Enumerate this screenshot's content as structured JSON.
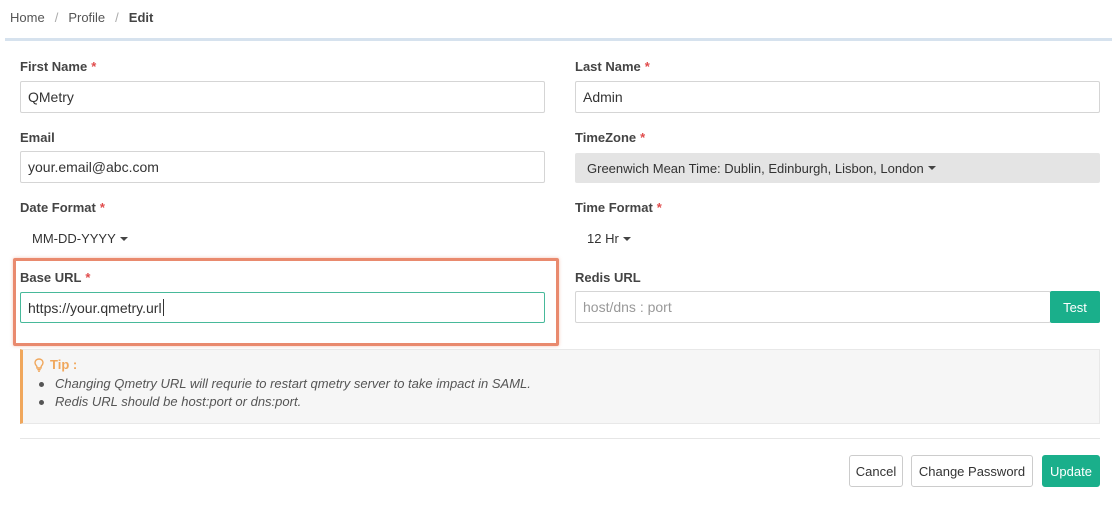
{
  "breadcrumb": {
    "home": "Home",
    "profile": "Profile",
    "current": "Edit",
    "separator": "/"
  },
  "form": {
    "first_name": {
      "label": "First Name",
      "required": "*",
      "value": "QMetry"
    },
    "last_name": {
      "label": "Last Name",
      "required": "*",
      "value": "Admin"
    },
    "email": {
      "label": "Email",
      "value": "your.email@abc.com"
    },
    "timezone": {
      "label": "TimeZone",
      "required": "*",
      "value": "Greenwich Mean Time: Dublin, Edinburgh, Lisbon, London"
    },
    "date_format": {
      "label": "Date Format",
      "required": "*",
      "value": "MM-DD-YYYY"
    },
    "time_format": {
      "label": "Time Format",
      "required": "*",
      "value": "12 Hr"
    },
    "base_url": {
      "label": "Base URL",
      "required": "*",
      "value": "https://your.qmetry.url"
    },
    "redis_url": {
      "label": "Redis URL",
      "placeholder": "host/dns : port",
      "test_label": "Test"
    }
  },
  "tip": {
    "title": "Tip :",
    "items": [
      "Changing Qmetry URL will requrie to restart qmetry server to take impact in SAML.",
      "Redis URL should be host:port or dns:port."
    ]
  },
  "actions": {
    "cancel": "Cancel",
    "change_password": "Change Password",
    "update": "Update"
  },
  "colors": {
    "accent": "#1aaf8b",
    "required": "#e04b4b",
    "tip": "#f0a75c",
    "highlight": "#e98a6e"
  }
}
